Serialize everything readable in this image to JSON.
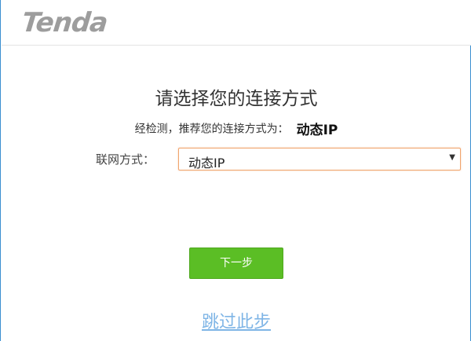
{
  "header": {
    "logo_text": "Tenda"
  },
  "main": {
    "title": "请选择您的连接方式",
    "detect_label": "经检测，推荐您的连接方式为：",
    "detect_value": "动态IP",
    "connection_label": "联网方式：",
    "connection_select": {
      "selected": "动态IP"
    },
    "next_button": "下一步",
    "skip_link": "跳过此步"
  },
  "colors": {
    "accent_green": "#5bbe25",
    "select_border": "#f0a46c",
    "link_blue": "#7fb5e6",
    "window_border": "#3a8fd0"
  }
}
